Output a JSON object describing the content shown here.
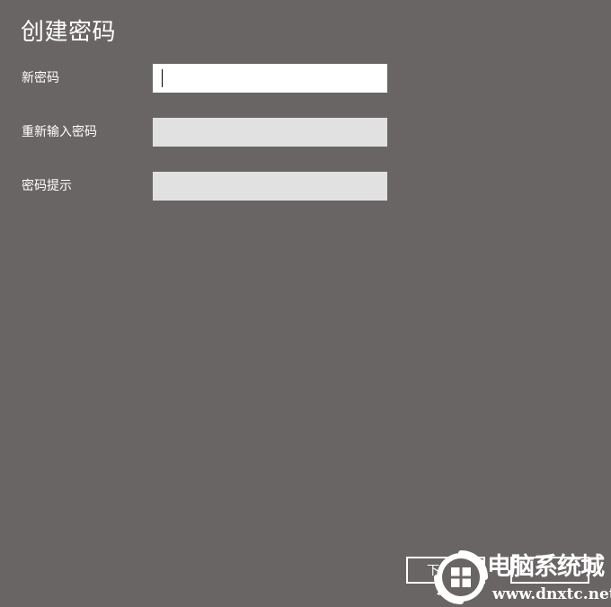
{
  "page": {
    "title": "创建密码"
  },
  "form": {
    "new_password": {
      "label": "新密码",
      "value": ""
    },
    "confirm_password": {
      "label": "重新输入密码",
      "value": ""
    },
    "password_hint": {
      "label": "密码提示",
      "value": ""
    }
  },
  "footer": {
    "next_label": "下一步",
    "back_label": ""
  },
  "watermark": {
    "name": "电脑系统城",
    "url": "www.dnxtc.net"
  },
  "colors": {
    "background": "#696564",
    "active_input": "#ffffff",
    "inactive_input": "#e1e1e1",
    "text": "#ffffff"
  }
}
